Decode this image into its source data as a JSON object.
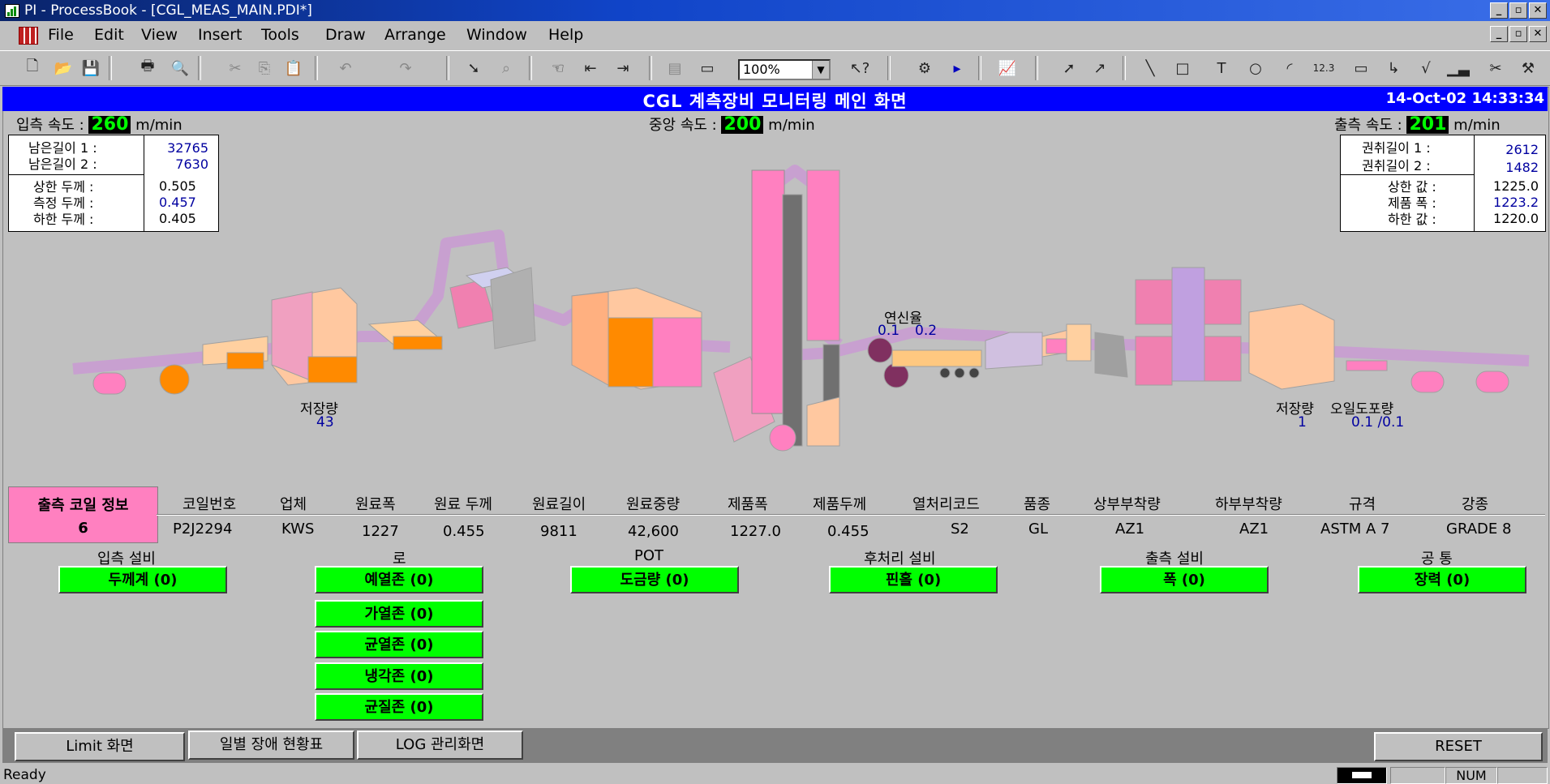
{
  "window": {
    "title": "PI - ProcessBook - [CGL_MEAS_MAIN.PDI*]",
    "buttons": [
      "_",
      "▫",
      "✕"
    ]
  },
  "menu": [
    "File",
    "Edit",
    "View",
    "Insert",
    "Tools",
    "Draw",
    "Arrange",
    "Window",
    "Help"
  ],
  "toolbar": {
    "zoom": "100%"
  },
  "screen": {
    "title": "CGL 계측장비 모니터링 메인 화면",
    "datetime": "14-Oct-02 14:33:34"
  },
  "speeds": {
    "entry_label": "입측 속도 :",
    "entry_value": "260",
    "center_label": "중앙 속도 :",
    "center_value": "200",
    "exit_label": "출측 속도 :",
    "exit_value": "201",
    "unit": "m/min"
  },
  "left_info": {
    "rows": [
      {
        "label": "남은길이 1 :",
        "value": "32765"
      },
      {
        "label": "남은길이 2 :",
        "value": "7630"
      },
      {
        "label": "상한 두께 :",
        "value": "0.505"
      },
      {
        "label": "측정 두께 :",
        "value": "0.457"
      },
      {
        "label": "하한 두께 :",
        "value": "0.405"
      }
    ]
  },
  "right_info": {
    "rows": [
      {
        "label": "권취길이 1 :",
        "value": "2612"
      },
      {
        "label": "권취길이 2 :",
        "value": "1482"
      },
      {
        "label": "상한 값 :",
        "value": "1225.0"
      },
      {
        "label": "제품 폭 :",
        "value": "1223.2"
      },
      {
        "label": "하한 값 :",
        "value": "1220.0"
      }
    ]
  },
  "process": {
    "storage_left_label": "저장량",
    "storage_left_value": "43",
    "elongation_label": "연신율",
    "elongation_v1": "0.1",
    "elongation_v2": "0.2",
    "storage_right_label": "저장량",
    "storage_right_value": "1",
    "oil_label": "오일도포량",
    "oil_value": "0.1 /0.1"
  },
  "coil": {
    "title": "출측 코일 정보",
    "count": "6",
    "headers": [
      "코일번호",
      "업체",
      "원료폭",
      "원료 두께",
      "원료길이",
      "원료중량",
      "제품폭",
      "제품두께",
      "열처리코드",
      "품종",
      "상부부착량",
      "하부부착량",
      "규격",
      "강종"
    ],
    "values": [
      "P2J2294",
      "KWS",
      "1227",
      "0.455",
      "9811",
      "42,600",
      "1227.0",
      "0.455",
      "S2",
      "GL",
      "AZ1",
      "AZ1",
      "ASTM A 7",
      "GRADE 8"
    ]
  },
  "equipment": {
    "groups": [
      {
        "label": "입측 설비",
        "buttons": [
          "두께계 (0)"
        ]
      },
      {
        "label": "로",
        "buttons": [
          "예열존 (0)",
          "가열존 (0)",
          "균열존 (0)",
          "냉각존 (0)",
          "균질존 (0)"
        ]
      },
      {
        "label": "POT",
        "buttons": [
          "도금량 (0)"
        ]
      },
      {
        "label": "후처리 설비",
        "buttons": [
          "핀홀 (0)"
        ]
      },
      {
        "label": "출측 설비",
        "buttons": [
          "폭 (0)"
        ]
      },
      {
        "label": "공 통",
        "buttons": [
          "장력 (0)"
        ]
      }
    ]
  },
  "bottom_buttons": [
    "Limit 화면",
    "일별 장애 현황표",
    "LOG 관리화면",
    "RESET"
  ],
  "status": {
    "text": "Ready",
    "num": "NUM"
  },
  "colors": {
    "header_bg": "#0000ff",
    "lcd_fg": "#00ff00",
    "status_ok": "#00ff00",
    "coil_header": "#ff80c0"
  }
}
